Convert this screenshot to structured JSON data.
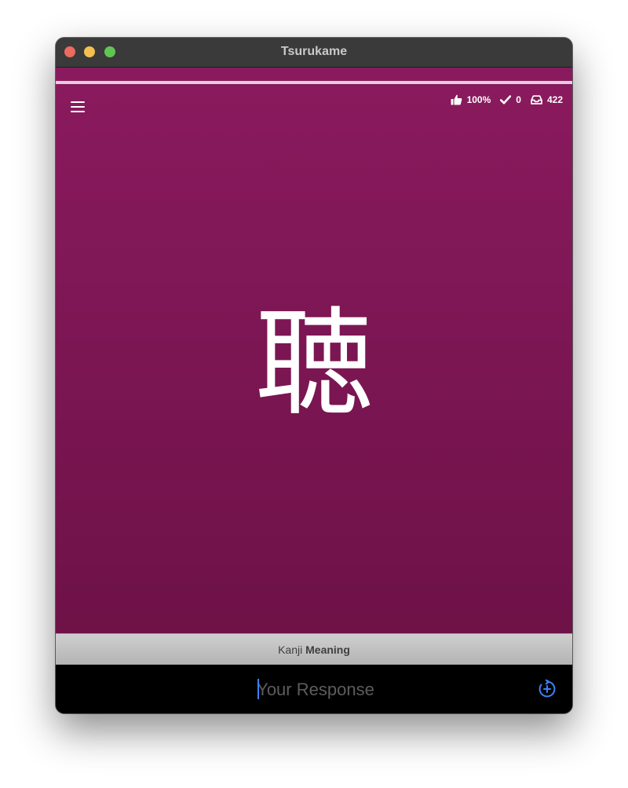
{
  "window": {
    "title": "Tsurukame"
  },
  "colors": {
    "kanji_background": "#7e175a",
    "accent": "#3b82f6"
  },
  "session": {
    "progress": 1.0
  },
  "stats": {
    "success_rate": "100%",
    "done_count": "0",
    "queue_count": "422"
  },
  "icons": {
    "menu": "hamburger-menu-icon",
    "success": "thumbs-up-icon",
    "done": "checkmark-icon",
    "queue": "inbox-tray-icon",
    "add_synonym": "circle-plus-refresh-icon"
  },
  "subject": {
    "character": "聴"
  },
  "prompt": {
    "subject_kind": "Kanji",
    "task_type": "Meaning"
  },
  "answer": {
    "value": "",
    "placeholder": "Your Response"
  }
}
